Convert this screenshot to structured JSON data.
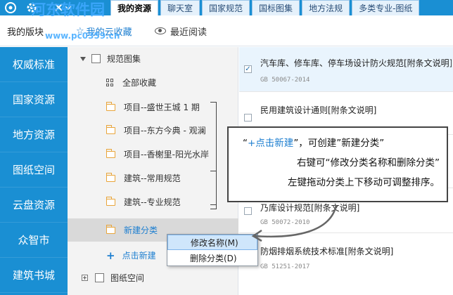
{
  "toolbar": {
    "tabs": [
      {
        "label": "我的资源",
        "active": true
      },
      {
        "label": "聊天室",
        "active": false
      },
      {
        "label": "国家规范",
        "active": false
      },
      {
        "label": "国标图集",
        "active": false
      },
      {
        "label": "地方法规",
        "active": false
      },
      {
        "label": "多类专业-图纸",
        "active": false
      }
    ],
    "icons": [
      "logo-icon",
      "gear-icon",
      "tools-icon"
    ]
  },
  "subbar": {
    "my_block": "我的版块",
    "my_favorites": "我的云收藏",
    "recent_read": "最近阅读"
  },
  "left_nav": [
    "权威标准",
    "国家资源",
    "地方资源",
    "图纸空间",
    "云盘资源",
    "众智市",
    "建筑书城"
  ],
  "tree": {
    "root_label": "规范图集",
    "all_favorites": "全部收藏",
    "folders": [
      "项目--盛世王城 1 期",
      "项目--东方今典 - 观澜",
      "项目--香榭里-阳光水岸",
      "建筑--常用规范",
      "建筑--专业规范",
      "新建分类"
    ],
    "add_label": "点击新建",
    "drawing_space": "图纸空间"
  },
  "list": [
    {
      "title": "汽车库、修车库、停车场设计防火规范[附条文说明]",
      "code": "GB 50067-2014",
      "checked": true
    },
    {
      "title": "民用建筑设计通则[附条文说明]",
      "code": "",
      "checked": false
    },
    {
      "title": "",
      "code": "",
      "checked": false
    },
    {
      "title": "乃库设计规范[附条文说明]",
      "code": "GB 50072-2010",
      "checked": false
    },
    {
      "title": "防烟排烟系统技术标准[附条文说明]",
      "code": "GB 51251-2017",
      "checked": false
    }
  ],
  "tooltip": {
    "line1_pre": "“",
    "line1_hl": "+点击新建",
    "line1_post": "”，可创建”新建分类”",
    "line2": "右键可“修改分类名称和删除分类”",
    "line3": "左键拖动分类上下移动可调整排序。"
  },
  "context_menu": [
    "修改名称(M)",
    "删除分类(D)"
  ],
  "watermark": {
    "title": "河东软件园",
    "url": "www.pc0359.cn"
  },
  "colors": {
    "accent": "#1a8fd3",
    "link": "#1e7fd0",
    "folder": "#e9a53a"
  }
}
